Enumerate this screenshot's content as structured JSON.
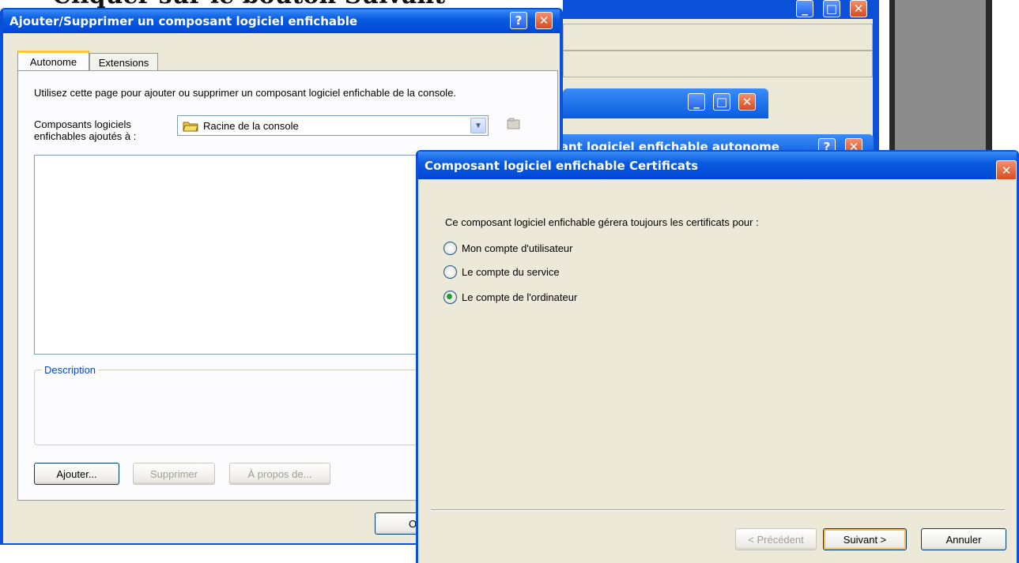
{
  "caption": {
    "text": "Cliquer sur le bouton Suivant"
  },
  "main_dialog": {
    "title": "Ajouter/Supprimer un composant logiciel enfichable",
    "help_btn": "?",
    "close_btn": "✕",
    "tabs": [
      {
        "label": "Autonome"
      },
      {
        "label": "Extensions"
      }
    ],
    "intro": "Utilisez cette page pour ajouter ou supprimer un composant logiciel enfichable de la console.",
    "added_to_label": "Composants logiciels enfichables ajoutés à :",
    "combo_value": "Racine de la console",
    "description_label": "Description",
    "buttons": {
      "add": "Ajouter...",
      "remove": "Supprimer",
      "about": "À propos de..."
    },
    "ok_partial": "O"
  },
  "background": {
    "title_partial": "Ajout d'un composant logiciel enfichable autonome"
  },
  "cert_dialog": {
    "title": "Composant logiciel enfichable Certificats",
    "close_btn": "✕",
    "prompt": "Ce composant logiciel enfichable gérera toujours les certificats pour :",
    "options": [
      {
        "label": "Mon compte d'utilisateur",
        "selected": false
      },
      {
        "label": "Le compte du service",
        "selected": false
      },
      {
        "label": "Le compte de l'ordinateur",
        "selected": true
      }
    ],
    "buttons": {
      "back": "< Précédent",
      "next": "Suivant >",
      "cancel": "Annuler"
    }
  }
}
